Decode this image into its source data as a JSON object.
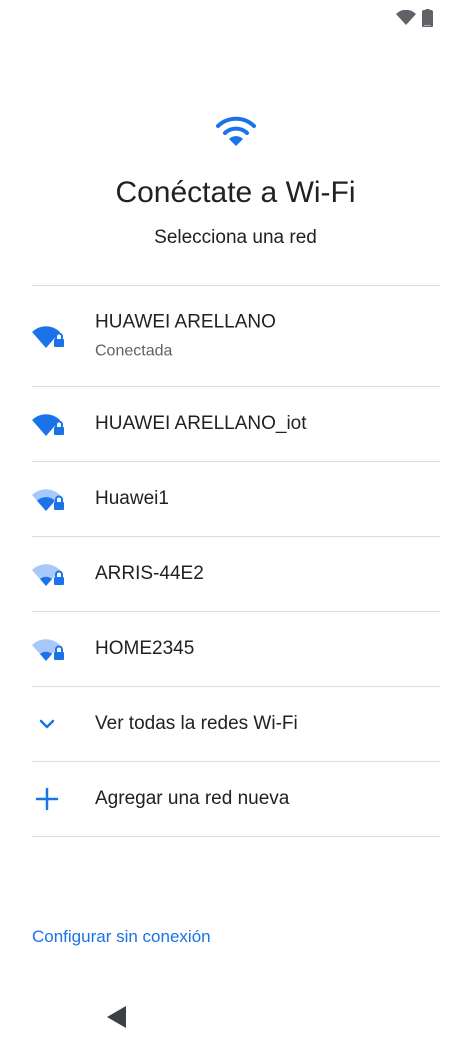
{
  "status_bar": {
    "icons": [
      "wifi-signal-icon",
      "battery-icon"
    ]
  },
  "header": {
    "icon": "wifi-icon",
    "title": "Conéctate a Wi-Fi",
    "subtitle": "Selecciona una red"
  },
  "networks": [
    {
      "name": "HUAWEI ARELLANO",
      "status": "Conectada",
      "signal": 4,
      "locked": true
    },
    {
      "name": "HUAWEI ARELLANO_iot",
      "status": "",
      "signal": 4,
      "locked": true
    },
    {
      "name": "Huawei1",
      "status": "",
      "signal": 2,
      "locked": true
    },
    {
      "name": "ARRIS-44E2",
      "status": "",
      "signal": 1,
      "locked": true
    },
    {
      "name": "HOME2345",
      "status": "",
      "signal": 1,
      "locked": true
    }
  ],
  "actions": {
    "see_all": {
      "label": "Ver todas la redes Wi-Fi",
      "icon": "chevron-down-icon"
    },
    "add_network": {
      "label": "Agregar una red nueva",
      "icon": "plus-icon"
    }
  },
  "footer": {
    "offline_link": "Configurar sin conexión"
  },
  "nav": {
    "back_icon": "back-triangle-icon"
  },
  "colors": {
    "accent": "#1a73e8",
    "text": "#202124",
    "secondary_text": "#5f6368",
    "divider": "#dadce0",
    "signal_dim": "#a8c7fa"
  }
}
